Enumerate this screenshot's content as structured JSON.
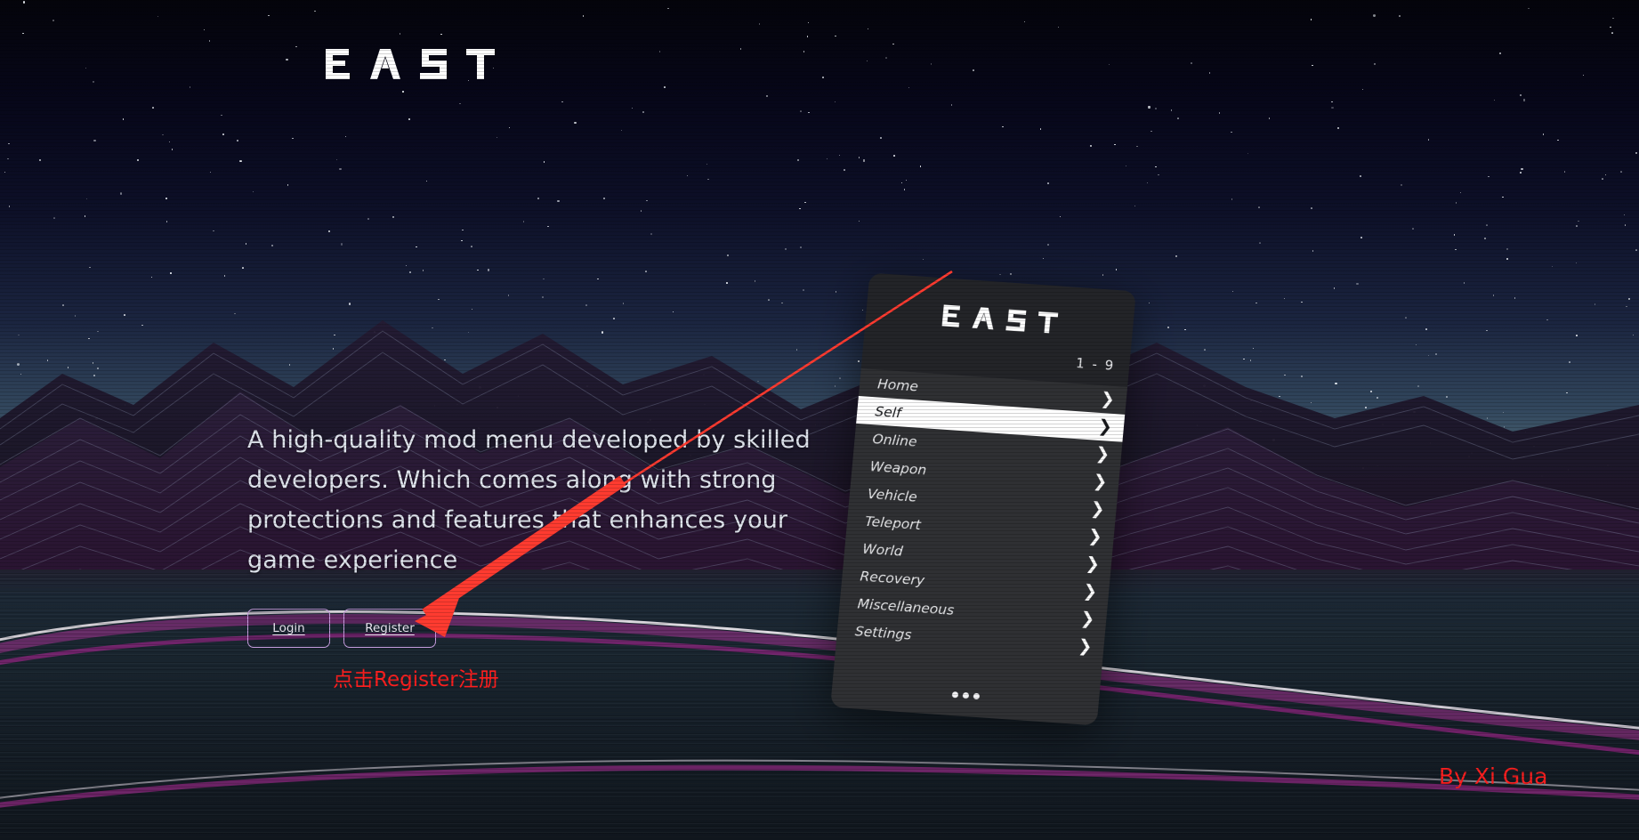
{
  "site": {
    "logo_text": "EAST",
    "logo_letters": [
      "E",
      "A",
      "S",
      "T"
    ]
  },
  "hero": {
    "paragraph": "A high-quality mod menu developed by skilled developers. Which comes along with strong protections and features that enhances your game experience"
  },
  "actions": {
    "login_label": "Login",
    "register_label": "Register"
  },
  "mod_menu": {
    "logo_text": "EAST",
    "counter": "1 - 9",
    "more_label": "•••",
    "items": [
      {
        "label": "Home",
        "chevron": "❯",
        "active": false
      },
      {
        "label": "Self",
        "chevron": "❯",
        "active": true
      },
      {
        "label": "Online",
        "chevron": "❯",
        "active": false
      },
      {
        "label": "Weapon",
        "chevron": "❯",
        "active": false
      },
      {
        "label": "Vehicle",
        "chevron": "❯",
        "active": false
      },
      {
        "label": "Teleport",
        "chevron": "❯",
        "active": false
      },
      {
        "label": "World",
        "chevron": "❯",
        "active": false
      },
      {
        "label": "Recovery",
        "chevron": "❯",
        "active": false
      },
      {
        "label": "Miscellaneous",
        "chevron": "❯",
        "active": false
      },
      {
        "label": "Settings",
        "chevron": "❯",
        "active": false
      }
    ]
  },
  "annotations": {
    "instruction_cn": "点击Register注册",
    "credit": "By Xi Gua",
    "arrow_color": "#ff3b30"
  },
  "colors": {
    "accent_purple": "#c79ee0",
    "menu_bg": "#2f3033",
    "menu_header_bg": "#232428",
    "highlight": "#ffffff",
    "annotation_red": "#ff1f1f",
    "text_light": "#dfe4ec"
  }
}
